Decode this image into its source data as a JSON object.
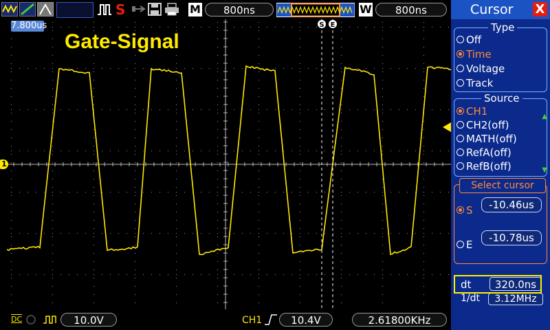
{
  "title": "Gate-Signal",
  "top": {
    "stop_symbol": "S",
    "mode_box": "M",
    "timebase": "800ns",
    "window_box": "W",
    "window_timebase": "800ns"
  },
  "screen": {
    "trigger_time": "7.800us",
    "ch1_marker": "1",
    "cursor_s_label": "S",
    "cursor_e_label": "E"
  },
  "bottom": {
    "volt_div": "10.0V",
    "trigger_channel": "CH1",
    "trigger_level": "10.4V",
    "frequency": "2.61800KHz",
    "coupling_label": "DC"
  },
  "panel": {
    "title": "Cursor",
    "close": "X",
    "type_title": "Type",
    "type_options": [
      "Off",
      "Time",
      "Voltage",
      "Track"
    ],
    "source_title": "Source",
    "source_options": [
      "CH1",
      "CH2(off)",
      "MATH(off)",
      "RefA(off)",
      "RefB(off)"
    ],
    "select_title": "Select cursor",
    "s_label": "S",
    "s_value": "-10.46us",
    "e_label": "E",
    "e_value": "-10.78us",
    "dt_label": "dt",
    "dt_value": "320.0ns",
    "inv_dt_label": "1/dt",
    "inv_dt_value": "3.12MHz"
  },
  "colors": {
    "trace": "#ffea00",
    "panel_bg": "#0b2a8c",
    "accent_orange": "#ff8a3a",
    "highlight": "#fff200"
  }
}
